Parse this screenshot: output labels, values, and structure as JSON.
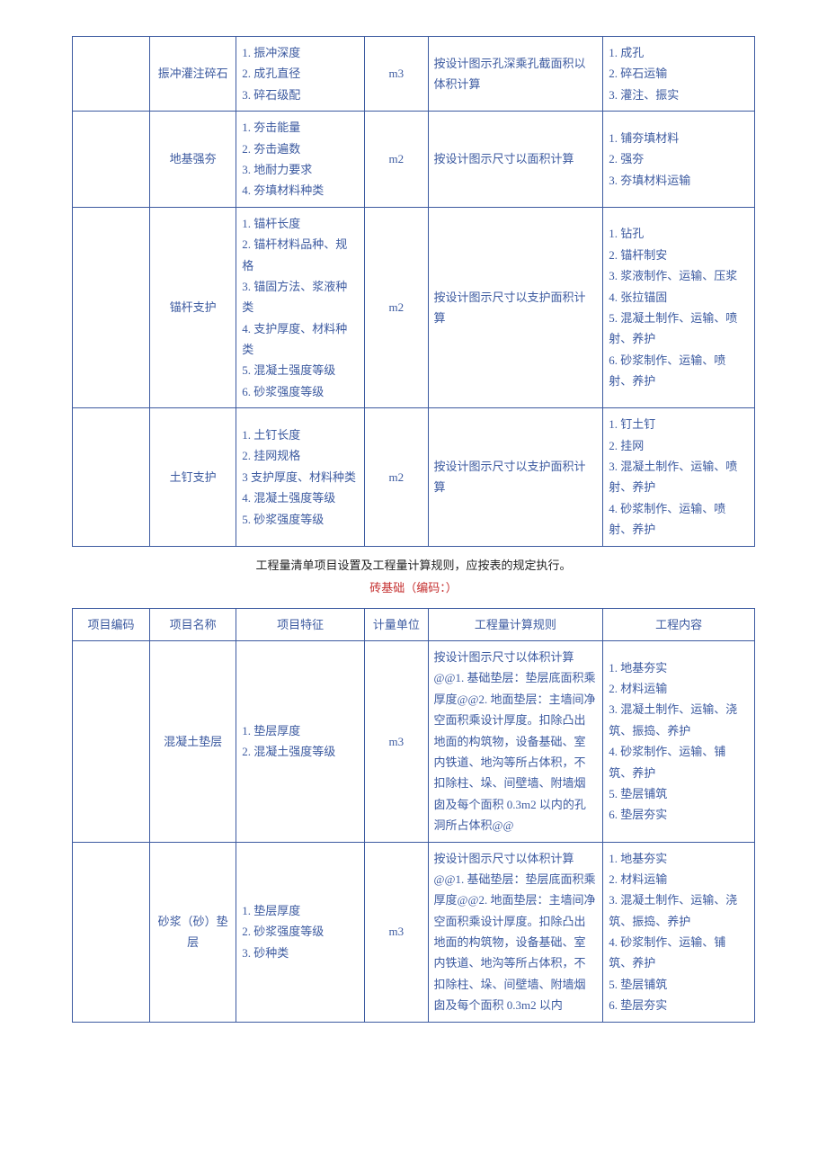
{
  "table1": {
    "rows": [
      {
        "name": "振冲灌注碎石",
        "features": "1. 振冲深度\n2. 成孔直径\n3. 碎石级配",
        "unit": "m3",
        "rule": "按设计图示孔深乘孔截面积以体积计算",
        "content": "1. 成孔\n2. 碎石运输\n3. 灌注、振实"
      },
      {
        "name": "地基强夯",
        "features": "1. 夯击能量\n2. 夯击遍数\n3. 地耐力要求\n4. 夯填材料种类",
        "unit": "m2",
        "rule": "按设计图示尺寸以面积计算",
        "content": "1. 铺夯填材料\n2. 强夯\n3. 夯填材料运输"
      },
      {
        "name": "锚杆支护",
        "features": "1. 锚杆长度\n2. 锚杆材料品种、规格\n3. 锚固方法、浆液种类\n4. 支护厚度、材料种类\n5. 混凝土强度等级\n6. 砂浆强度等级",
        "unit": "m2",
        "rule": "按设计图示尺寸以支护面积计算",
        "content": "1. 钻孔\n2. 锚杆制安\n3. 浆液制作、运输、压浆\n4. 张拉锚固\n5. 混凝土制作、运输、喷射、养护\n6. 砂浆制作、运输、喷射、养护"
      },
      {
        "name": "土钉支护",
        "features": "1. 土钉长度\n2. 挂网规格\n3 支护厚度、材料种类\n4. 混凝土强度等级\n5. 砂浆强度等级",
        "unit": "m2",
        "rule": "按设计图示尺寸以支护面积计算",
        "content": "1. 钉土钉\n2. 挂网\n3. 混凝土制作、运输、喷射、养护\n4. 砂浆制作、运输、喷射、养护"
      }
    ]
  },
  "note_text": "工程量清单项目设置及工程量计算规则，应按表的规定执行。",
  "red_title": "砖基础（编码：）",
  "table2": {
    "headers": {
      "code": "项目编码",
      "name": "项目名称",
      "feat": "项目特征",
      "unit": "计量单位",
      "rule": "工程量计算规则",
      "content": "工程内容"
    },
    "rows": [
      {
        "name": "混凝土垫层",
        "features": "1. 垫层厚度\n2. 混凝土强度等级",
        "unit": "m3",
        "rule": "按设计图示尺寸以体积计算@@1. 基础垫层：垫层底面积乘厚度@@2. 地面垫层：主墙间净空面积乘设计厚度。扣除凸出地面的构筑物，设备基础、室内铁道、地沟等所占体积，不扣除柱、垛、间壁墙、附墙烟囱及每个面积 0.3m2 以内的孔洞所占体积@@",
        "content": "1. 地基夯实\n2. 材料运输\n3. 混凝土制作、运输、浇筑、振捣、养护\n4. 砂浆制作、运输、铺筑、养护\n5. 垫层铺筑\n6. 垫层夯实"
      },
      {
        "name": "砂浆（砂）垫层",
        "features": "1. 垫层厚度\n2. 砂浆强度等级\n3. 砂种类",
        "unit": "m3",
        "rule": "按设计图示尺寸以体积计算@@1. 基础垫层：垫层底面积乘厚度@@2. 地面垫层：主墙间净空面积乘设计厚度。扣除凸出地面的构筑物，设备基础、室内铁道、地沟等所占体积，不扣除柱、垛、间壁墙、附墙烟囱及每个面积 0.3m2 以内",
        "content": "1. 地基夯实\n2. 材料运输\n3. 混凝土制作、运输、浇筑、振捣、养护\n4. 砂浆制作、运输、铺筑、养护\n5. 垫层铺筑\n6. 垫层夯实"
      }
    ]
  }
}
